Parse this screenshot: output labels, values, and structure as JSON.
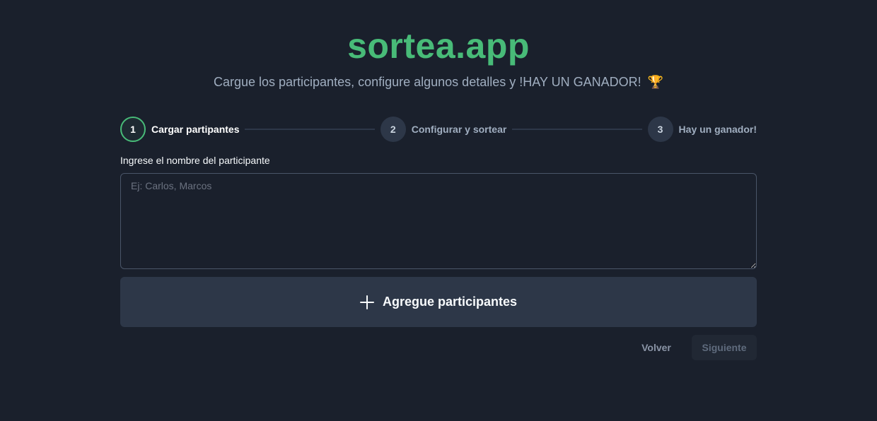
{
  "header": {
    "logo": "sortea.app",
    "tagline": "Cargue los participantes, configure algunos detalles y !HAY UN GANADOR!",
    "tagline_icon": "trophy-icon",
    "tagline_emoji": "🏆"
  },
  "stepper": {
    "steps": [
      {
        "number": "1",
        "label": "Cargar partipantes",
        "active": true
      },
      {
        "number": "2",
        "label": "Configurar y sortear",
        "active": false
      },
      {
        "number": "3",
        "label": "Hay un ganador!",
        "active": false
      }
    ]
  },
  "form": {
    "label": "Ingrese el nombre del participante",
    "placeholder": "Ej: Carlos, Marcos",
    "value": "",
    "add_button_label": "Agregue participantes",
    "add_button_icon": "plus-icon"
  },
  "navigation": {
    "back_label": "Volver",
    "next_label": "Siguiente",
    "next_disabled": true
  },
  "colors": {
    "background": "#1a202c",
    "accent": "#48bb78",
    "surface": "#2d3748",
    "muted_text": "#a0aec0"
  }
}
